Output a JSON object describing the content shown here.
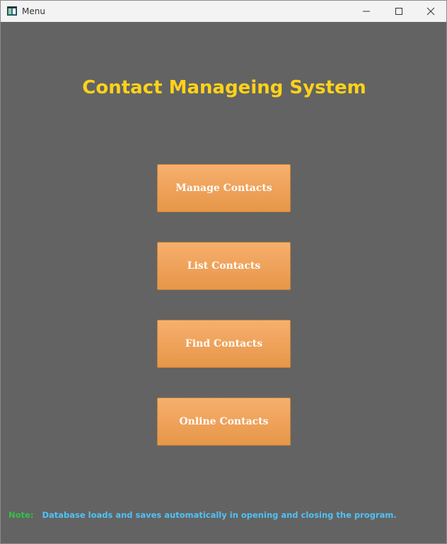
{
  "window": {
    "title": "Menu",
    "icons": {
      "app": "app-window-icon",
      "minimize": "minimize-icon",
      "maximize": "maximize-icon",
      "close": "close-icon"
    }
  },
  "main": {
    "heading": "Contact Manageing System",
    "buttons": [
      {
        "label": "Manage Contacts"
      },
      {
        "label": "List Contacts"
      },
      {
        "label": "Find Contacts"
      },
      {
        "label": "Online Contacts"
      }
    ]
  },
  "footer": {
    "note_label": "Note:",
    "note_text": "Database loads and saves automatically in opening and closing the program."
  },
  "colors": {
    "background": "#636363",
    "heading": "#ffd21a",
    "button": "#eea159",
    "note_label": "#33c24a",
    "note_text": "#4fc3f7"
  }
}
